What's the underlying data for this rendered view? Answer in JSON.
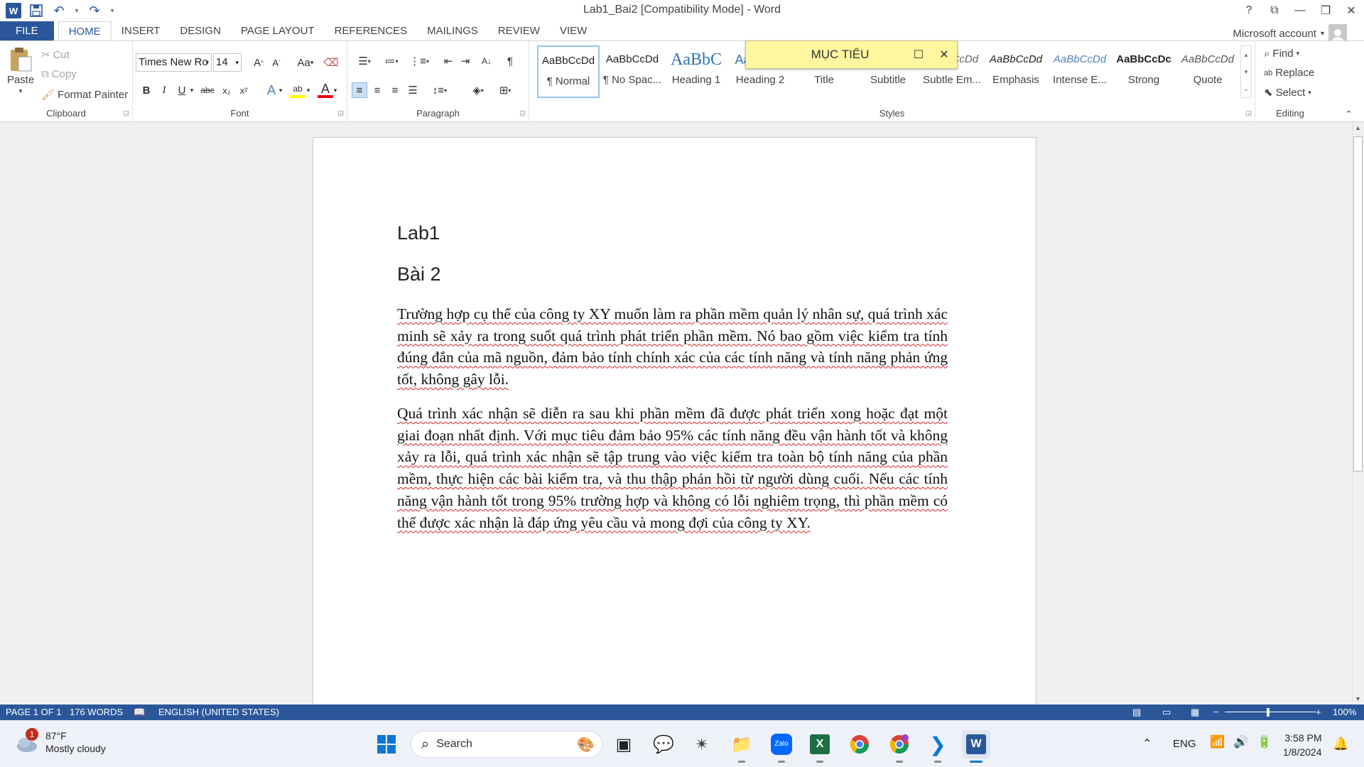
{
  "window": {
    "title": "Lab1_Bai2 [Compatibility Mode] - Word",
    "help": "?",
    "account": "Microsoft account"
  },
  "tabs": [
    "FILE",
    "HOME",
    "INSERT",
    "DESIGN",
    "PAGE LAYOUT",
    "REFERENCES",
    "MAILINGS",
    "REVIEW",
    "VIEW"
  ],
  "clipboard": {
    "paste": "Paste",
    "cut": "Cut",
    "copy": "Copy",
    "format_painter": "Format Painter",
    "label": "Clipboard"
  },
  "font": {
    "name": "Times New Ro",
    "size": "14",
    "label": "Font",
    "case": "Aa",
    "bold": "B",
    "italic": "I",
    "underline": "U",
    "strike": "abc",
    "sub": "x₂",
    "sup": "x²"
  },
  "paragraph": {
    "label": "Paragraph",
    "pilcrow": "¶"
  },
  "styles": {
    "label": "Styles",
    "items": [
      {
        "preview": "AaBbCcDd",
        "name": "¶ Normal"
      },
      {
        "preview": "AaBbCcDd",
        "name": "¶ No Spac..."
      },
      {
        "preview": "AaBbC",
        "name": "Heading 1"
      },
      {
        "preview": "AaBbCcI",
        "name": "Heading 2"
      },
      {
        "preview": "AaB",
        "name": "Title"
      },
      {
        "preview": "AaBbCcD",
        "name": "Subtitle"
      },
      {
        "preview": "AaBbCcDd",
        "name": "Subtle Em..."
      },
      {
        "preview": "AaBbCcDd",
        "name": "Emphasis"
      },
      {
        "preview": "AaBbCcDd",
        "name": "Intense E..."
      },
      {
        "preview": "AaBbCcDc",
        "name": "Strong"
      },
      {
        "preview": "AaBbCcDd",
        "name": "Quote"
      }
    ]
  },
  "editing": {
    "find": "Find",
    "replace": "Replace",
    "select": "Select",
    "label": "Editing"
  },
  "popup": {
    "title": "MỤC TIÊU"
  },
  "document": {
    "heading1": "Lab1",
    "heading2": "Bài 2",
    "para1": "Trường hợp cụ thể của công ty XY muốn làm ra phần mềm quản lý nhân sự, quá trình xác minh sẽ xảy ra trong suốt quá trình phát triển phần mềm. Nó bao gồm việc kiểm tra tính đúng đắn của mã nguồn, đảm bảo tính chính xác của các tính năng và tính năng phản ứng tốt, không gây lỗi.",
    "para2": "Quá trình xác nhận sẽ diễn ra sau khi phần mềm đã được phát triển xong hoặc đạt một giai đoạn nhất định. Với mục tiêu đảm bảo 95% các tính năng đều vận hành tốt và không xảy ra lỗi, quá trình xác nhận sẽ tập trung vào việc kiểm tra toàn bộ tính năng của phần mềm, thực hiện các bài kiểm tra, và thu thập phản hồi từ người dùng cuối. Nếu các tính năng vận hành tốt trong 95% trường hợp và không có lỗi nghiêm trọng, thì phần mềm có thể được xác nhận là đáp ứng yêu cầu và mong đợi của công ty XY."
  },
  "status": {
    "page": "PAGE 1 OF 1",
    "words": "176 WORDS",
    "language": "ENGLISH (UNITED STATES)",
    "zoom": "100%"
  },
  "taskbar": {
    "weather_temp": "87°F",
    "weather_desc": "Mostly cloudy",
    "weather_badge": "1",
    "search": "Search",
    "lang": "ENG",
    "time": "3:58 PM",
    "date": "1/8/2024"
  },
  "colors": {
    "accent": "#2b579a",
    "popup": "#fff7a0",
    "spell": "#dd2222"
  }
}
